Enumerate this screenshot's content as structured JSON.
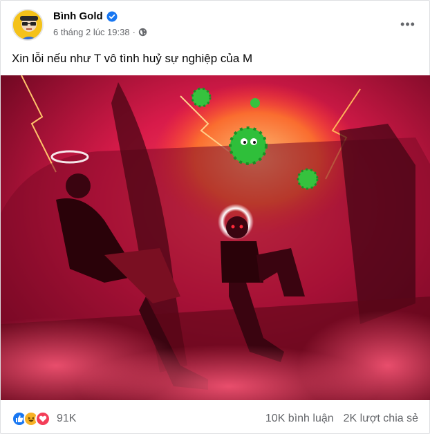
{
  "post": {
    "author": "Bình Gold",
    "timestamp": "6 tháng 2 lúc 19:38",
    "separator": "·",
    "privacy_icon": "globe-icon",
    "verified_icon": "verified-badge-icon",
    "more_icon": "more-options-icon",
    "more_label": "•••",
    "caption": "Xin lỗi nếu như T vô tình huỷ sự nghiệp của M"
  },
  "reactions": {
    "icons": [
      "like-icon",
      "haha-icon",
      "love-icon"
    ],
    "count": "91K"
  },
  "stats": {
    "comments": "10K bình luận",
    "shares": "2K lượt chia sẻ"
  },
  "colors": {
    "like": "#1877f2",
    "haha": "#f7b125",
    "love": "#f33e58",
    "verified": "#1877f2",
    "photo_bg": "#8a0d2a"
  }
}
